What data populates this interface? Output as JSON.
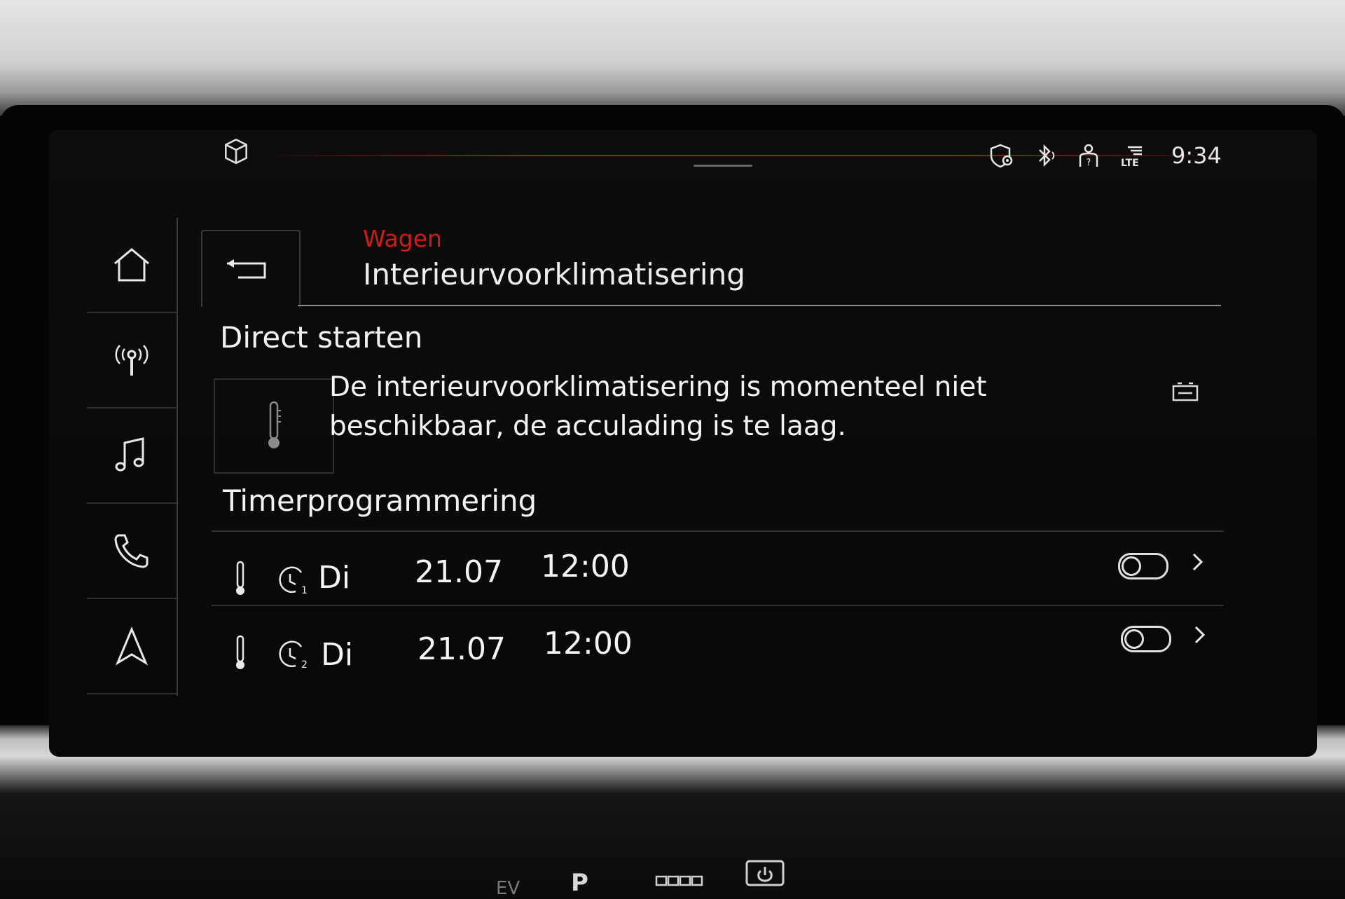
{
  "status_bar": {
    "icons": [
      "cube-icon",
      "shield-location-icon",
      "bluetooth-icon",
      "person-question-icon",
      "lte-signal-icon"
    ],
    "clock": "9:34"
  },
  "sidebar": {
    "items": [
      {
        "name": "home",
        "icon": "home-icon"
      },
      {
        "name": "radio",
        "icon": "radio-antenna-icon"
      },
      {
        "name": "media",
        "icon": "music-note-icon"
      },
      {
        "name": "phone",
        "icon": "phone-icon"
      },
      {
        "name": "navigation",
        "icon": "navigation-arrow-icon"
      }
    ]
  },
  "header": {
    "breadcrumb": "Wagen",
    "title": "Interieurvoorklimatisering",
    "back_icon": "back-arrow-icon"
  },
  "direct_start": {
    "title": "Direct starten",
    "icon": "thermometer-icon",
    "message": "De interieurvoorklimatisering is momenteel niet beschikbaar, de acculading is te laag.",
    "status_icon": "battery-icon"
  },
  "timers": {
    "title": "Timerprogrammering",
    "rows": [
      {
        "timer_icon": "timer-1-icon",
        "day": "Di",
        "date": "21.07",
        "time": "12:00",
        "enabled": false
      },
      {
        "timer_icon": "timer-2-icon",
        "day": "Di",
        "date": "21.07",
        "time": "12:00",
        "enabled": false
      }
    ]
  },
  "console": {
    "ev_label": "EV",
    "park_label": "P"
  },
  "colors": {
    "accent": "#d11c1c",
    "text": "#f2f2f2",
    "background": "#0a0a0a"
  }
}
